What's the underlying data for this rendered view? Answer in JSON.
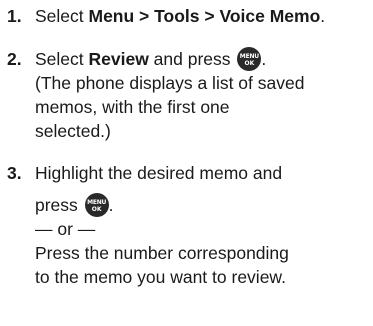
{
  "steps": [
    {
      "number": "1.",
      "pre": "Select ",
      "bold": "Menu > Tools > Voice Memo",
      "post": "."
    },
    {
      "number": "2.",
      "pre": "Select ",
      "bold": "Review",
      "mid": " and press ",
      "end": ".",
      "note_lines": [
        "(The phone displays a list of saved",
        "memos, with the first one",
        "selected.)"
      ]
    },
    {
      "number": "3.",
      "line1": "Highlight the desired memo and",
      "line2_pre": "press ",
      "line2_end": ".",
      "separator": "— or —",
      "alt_lines": [
        "Press the number corresponding",
        "to the memo you want to review."
      ]
    }
  ],
  "key": {
    "top_label": "MENU",
    "bottom_label": "OK"
  }
}
